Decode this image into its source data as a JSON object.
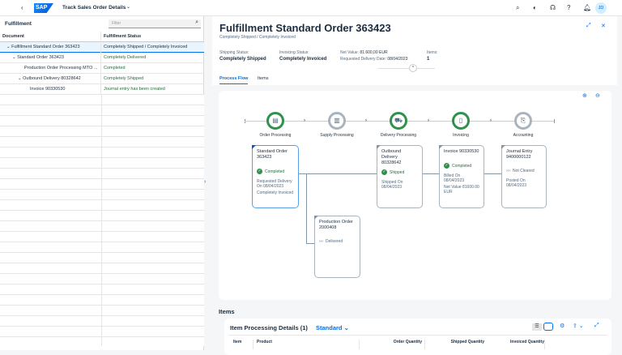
{
  "shell": {
    "title": "Track Sales Order Details",
    "logo": "SAP",
    "avatar": "JD"
  },
  "left": {
    "title": "Fulfillment",
    "filter_placeholder": "Filter",
    "col_document": "Document",
    "col_status": "Fulfillment Status",
    "rows": [
      {
        "doc": "Fulfillment Standard Order 363423",
        "status": "Completely Shipped / Completely Invoiced"
      },
      {
        "doc": "Standard Order 363423",
        "status": "Completely Delivered"
      },
      {
        "doc": "Production Order Processing MTO ...",
        "status": "Completed"
      },
      {
        "doc": "Outbound Delivery 80328642",
        "status": "Completely Shipped"
      },
      {
        "doc": "Invoice 90330530",
        "status": "Journal entry has been created"
      }
    ]
  },
  "header": {
    "title": "Fulfillment Standard Order 363423",
    "subtitle": "Completely Shipped / Completely Invoiced",
    "shipping_label": "Shipping Status:",
    "shipping_value": "Completely Shipped",
    "invoicing_label": "Invoicing Status:",
    "invoicing_value": "Completely Invoiced",
    "net_label": "Net Value:",
    "net_value": "81.600,00 EUR",
    "date_label": "Requested Delivery Date:",
    "date_value": "08/04/2023",
    "items_label": "Items:",
    "items_value": "1"
  },
  "tabs": [
    "Process Flow",
    "Items"
  ],
  "flow": {
    "lanes": [
      "Order Processing",
      "Supply Processing",
      "Delivery Processing",
      "Invoicing",
      "Accounting"
    ],
    "nodes": [
      {
        "title": "Standard Order 363423",
        "status": "Completed",
        "detail1": "Requested Delivery On 08/04/2023",
        "detail2": "Completely Invoiced"
      },
      {
        "title": "Outbound Delivery 80328642",
        "status": "Shipped",
        "detail1": "Shipped On 08/04/2023"
      },
      {
        "title": "Invoice 90330530",
        "status": "Completed",
        "detail1": "Billed On 08/04/2023",
        "detail2": "Net Value 81600.00 EUR"
      },
      {
        "title": "Journal Entry 9400000122",
        "status": "Not Cleared",
        "detail1": "Posted On 08/04/2023"
      },
      {
        "title": "Production Order 2000408",
        "status": "Delivered"
      }
    ]
  },
  "items": {
    "section_title": "Items",
    "table_title": "Item Processing Details (1)",
    "variant": "Standard",
    "columns": [
      "Item",
      "Product",
      "Order Quantity",
      "Shipped Quantity",
      "Invoiced Quantity"
    ]
  }
}
